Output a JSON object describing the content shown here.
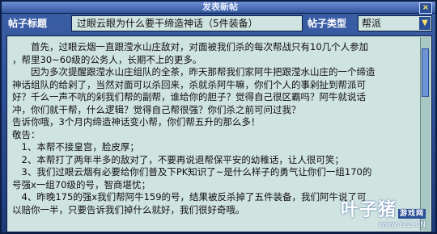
{
  "window": {
    "title": "发表新帖",
    "close_icon": "close-icon"
  },
  "header": {
    "subject_label": "帖子标题",
    "subject_value": "过眼云眼为什么要干缔造神话（5件装备）",
    "type_label": "帖子类型",
    "type_value": "帮派"
  },
  "body": {
    "lines": [
      "　　首先，过眼云烟一直跟滢水山庄敌对，对面被我们杀的每次帮战只有10几个人参加",
      "，帮里30~60级的公务人，长期不上的更多。",
      "　　因为多次提醒跟滢水山庄组队的全茶，昨天那帮我们家阿牛把跟滢水山庄的一个缔造",
      "神话组队的给剁了，当然对面可以杀回来，杀就杀阿牛嘛，你们个人的事剁扯到帮派可",
      "好？千么一声不吭的剁我们帮的副帮，谁给你的胆子？觉得自己很区霸吗？阿牛就说话",
      "冲，你们就干帮，什么逻辑？觉得自己帮很强？你们杀之前可问过我？",
      "告诉你哦，3个月内缔造神话变小帮，你们帮五升的那么多！",
      "敬告：",
      "　1、本帮不接皇宫，脸皮厚；",
      "　2、本帮打了两年半多的敌对了，不要再说退帮保平安的幼稚话，让人很可笑；",
      "　3、我们过眼云烟有必要给你们普及下PK知识了~是什么样子的勇气让你们一组170的",
      "号强x一组70级的号，智商堪忧；",
      "　4、昨晚175的强x我们帮阿牛159的号，结果被反杀掉了五件装备，我们阿牛说了可",
      "以赔你一半，只要告诉我们掉什么就好，我们很好奇哦。"
    ]
  },
  "watermark": {
    "main": "叶子猪",
    "tag": "游戏网",
    "url": "www.YZZ.CN"
  },
  "colors": {
    "panel": "#cfe3e0",
    "frame": "#1d3b78",
    "accent": "#ffe36a"
  }
}
